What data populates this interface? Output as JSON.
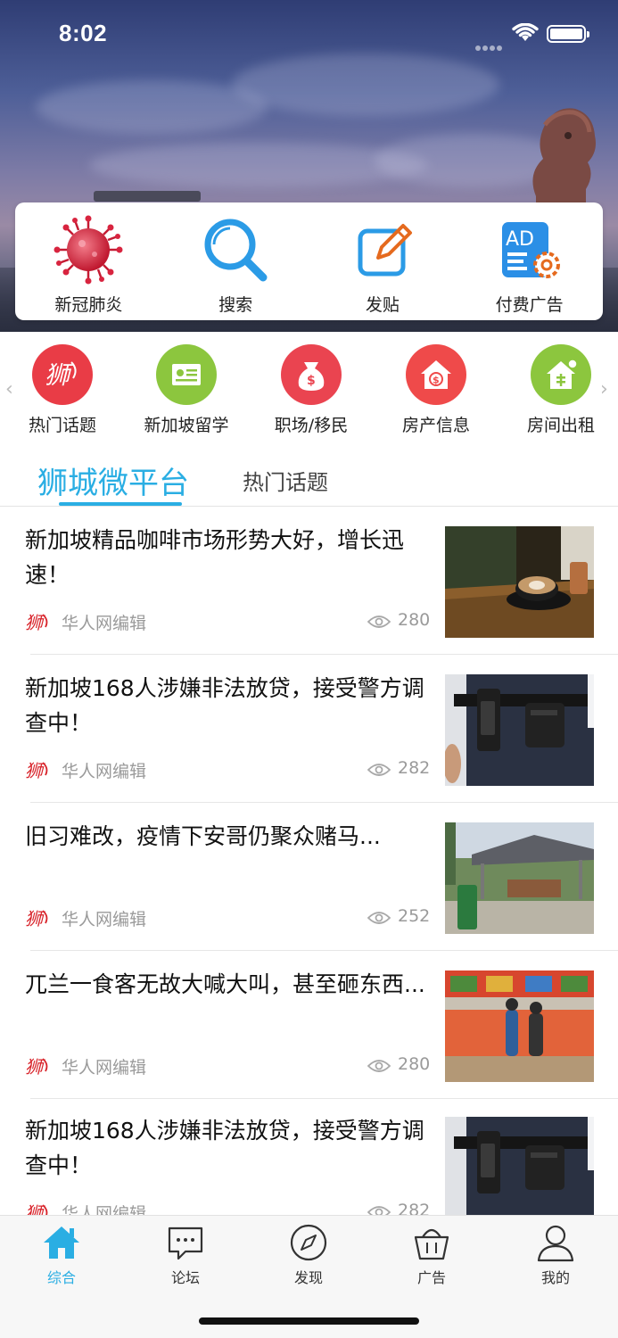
{
  "status_bar": {
    "time": "8:02"
  },
  "quick_actions": [
    {
      "label": "新冠肺炎",
      "icon": "virus-icon"
    },
    {
      "label": "搜索",
      "icon": "search-icon"
    },
    {
      "label": "发贴",
      "icon": "edit-post-icon"
    },
    {
      "label": "付费广告",
      "icon": "ad-settings-icon"
    }
  ],
  "categories": [
    {
      "label": "热门话题",
      "icon": "hot-topic-logo-icon",
      "color": "#e93c46"
    },
    {
      "label": "新加坡留学",
      "icon": "study-certificate-icon",
      "color": "#8cc63e"
    },
    {
      "label": "职场/移民",
      "icon": "money-bag-icon",
      "color": "#ea4450"
    },
    {
      "label": "房产信息",
      "icon": "house-money-icon",
      "color": "#ef4a4a"
    },
    {
      "label": "房间出租",
      "icon": "house-rent-icon",
      "color": "#8cc63e"
    }
  ],
  "tabs": {
    "active": "狮城微平台",
    "other": "热门话题"
  },
  "news": [
    {
      "title": "新加坡精品咖啡市场形势大好，增长迅速！",
      "author": "华人网编辑",
      "views": "280",
      "thumb": "coffee"
    },
    {
      "title": "新加坡168人涉嫌非法放贷，接受警方调查中！",
      "author": "华人网编辑",
      "views": "282",
      "thumb": "police"
    },
    {
      "title": "旧习难改，疫情下安哥仍聚众赌马...",
      "author": "华人网编辑",
      "views": "252",
      "thumb": "pavilion"
    },
    {
      "title": "兀兰一食客无故大喊大叫，甚至砸东西...",
      "author": "华人网编辑",
      "views": "280",
      "thumb": "foodcourt"
    },
    {
      "title": "新加坡168人涉嫌非法放贷，接受警方调查中！",
      "author": "华人网编辑",
      "views": "282",
      "thumb": "police"
    }
  ],
  "bottom_nav": [
    {
      "label": "综合",
      "icon": "home-icon",
      "active": true
    },
    {
      "label": "论坛",
      "icon": "chat-bubble-icon",
      "active": false
    },
    {
      "label": "发现",
      "icon": "compass-icon",
      "active": false
    },
    {
      "label": "广告",
      "icon": "basket-icon",
      "active": false
    },
    {
      "label": "我的",
      "icon": "user-icon",
      "active": false
    }
  ],
  "colors": {
    "accent": "#2aaee3",
    "meta_gray": "#9a9a9a"
  }
}
